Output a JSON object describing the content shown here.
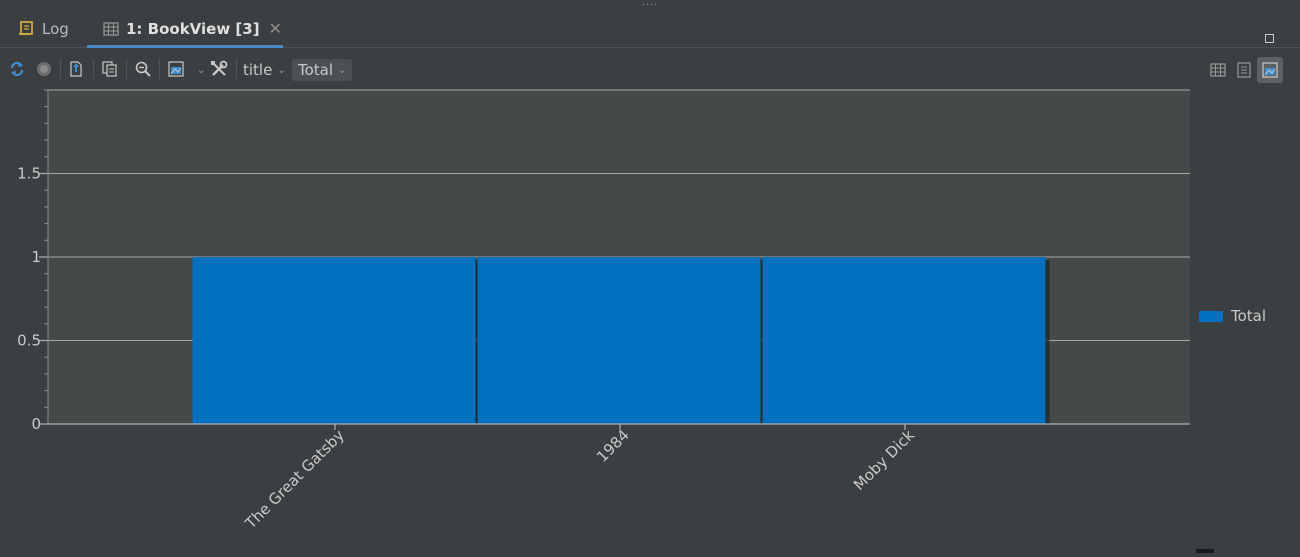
{
  "tabs": [
    {
      "label": "Log",
      "icon": "log-icon"
    },
    {
      "label": "1: BookView [3]",
      "icon": "table-icon",
      "active": true
    }
  ],
  "toolbar": {
    "group_by_label": "title",
    "measure_label": "Total"
  },
  "legend": {
    "label": "Total"
  },
  "colors": {
    "bar": "#0070bf",
    "accent": "#4a88c7",
    "background": "#3c3f41",
    "plot_bg": "#45494a"
  },
  "chart_data": {
    "type": "bar",
    "categories": [
      "The Great Gatsby",
      "1984",
      "Moby Dick"
    ],
    "series": [
      {
        "name": "Total",
        "values": [
          1,
          1,
          1
        ]
      }
    ],
    "ylim": [
      0,
      2
    ],
    "yticks": [
      0,
      0.5,
      1,
      1.5
    ],
    "ytick_labels": [
      "0",
      "0.5",
      "1",
      "1.5"
    ],
    "grid": true,
    "legend_position": "right"
  }
}
